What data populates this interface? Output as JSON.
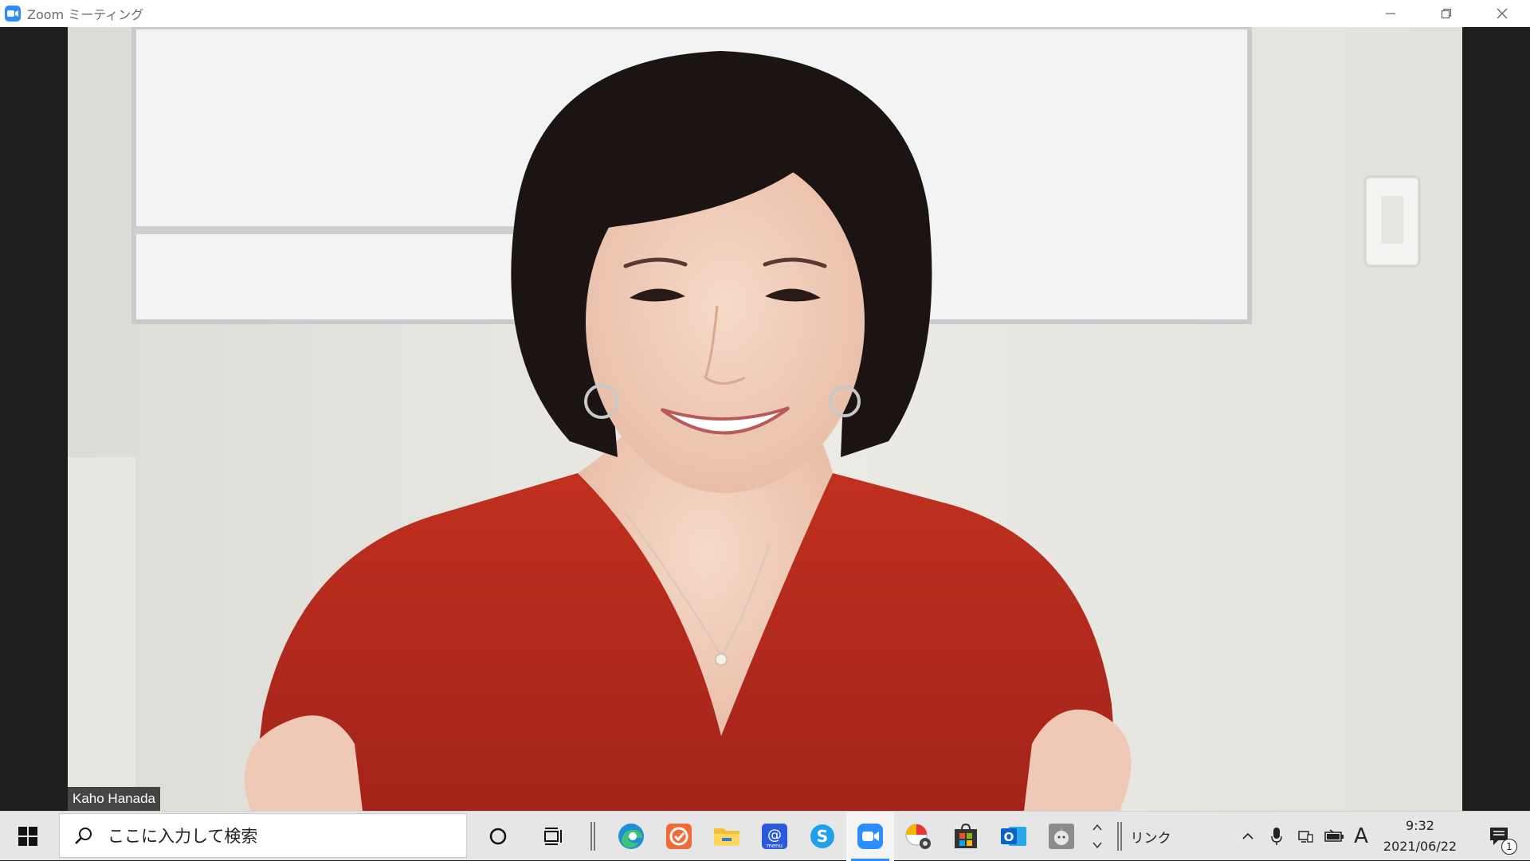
{
  "window": {
    "title": "Zoom ミーティング"
  },
  "meeting": {
    "participant_name": "Kaho Hanada"
  },
  "taskbar": {
    "search_placeholder": "ここに入力して検索",
    "links_label": "リンク",
    "ime_indicator": "A",
    "time": "9:32",
    "date": "2021/06/22",
    "notification_count": "1",
    "pinned_apps": [
      "cortana-icon",
      "task-view-icon",
      "edge-icon",
      "app-orange-icon",
      "file-explorer-icon",
      "menu-mail-icon",
      "skype-icon",
      "zoom-icon",
      "paint-icon",
      "store-icon",
      "outlook-icon",
      "app-gray-icon"
    ]
  },
  "colors": {
    "zoom_blue": "#2d8cff",
    "shirt_red": "#b5281e",
    "taskbar_bg": "#e6e6e6"
  }
}
